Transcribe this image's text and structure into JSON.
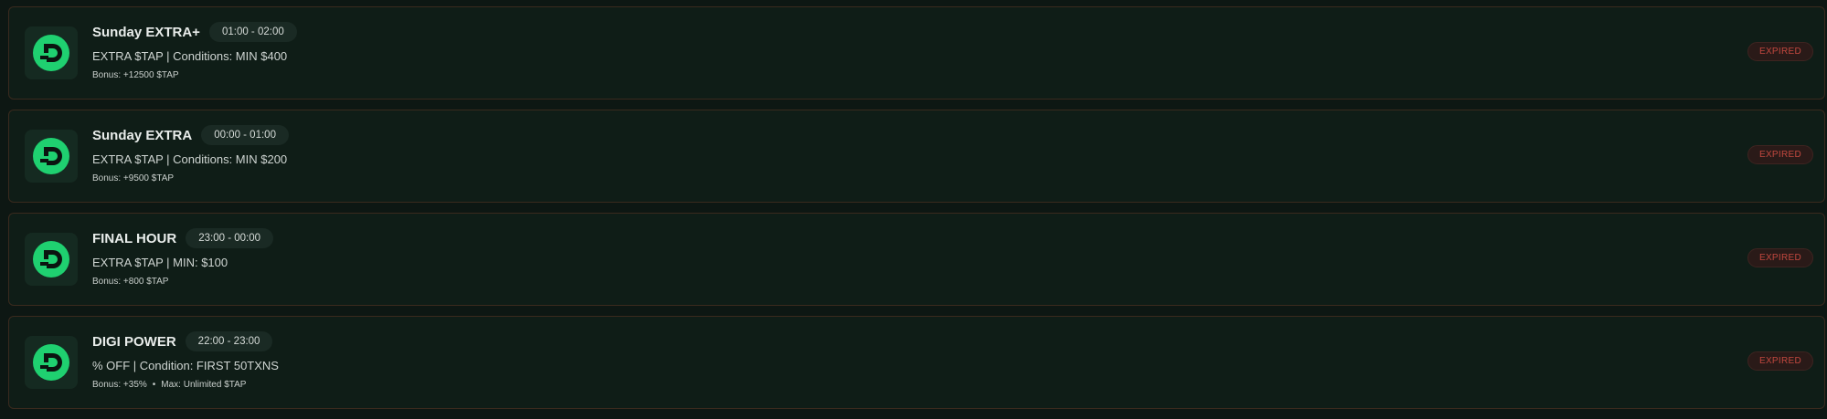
{
  "colors": {
    "background": "#0d1713",
    "card": "#0f1d17",
    "card_border": "#3a2a1e",
    "brand_green": "#1fd070",
    "expired_red": "#c2483f"
  },
  "promotions": [
    {
      "logo_icon": "digi-logo-icon",
      "title": "Sunday EXTRA+",
      "time": "01:00 - 02:00",
      "description": "EXTRA $TAP | Conditions: MIN $400",
      "bonus": "Bonus: +12500 $TAP",
      "max": "",
      "status": "EXPIRED"
    },
    {
      "logo_icon": "digi-logo-icon",
      "title": "Sunday EXTRA",
      "time": "00:00 - 01:00",
      "description": "EXTRA $TAP | Conditions: MIN $200",
      "bonus": "Bonus: +9500 $TAP",
      "max": "",
      "status": "EXPIRED"
    },
    {
      "logo_icon": "digi-logo-icon",
      "title": "FINAL HOUR",
      "time": "23:00 - 00:00",
      "description": "EXTRA $TAP | MIN: $100",
      "bonus": "Bonus: +800 $TAP",
      "max": "",
      "status": "EXPIRED"
    },
    {
      "logo_icon": "digi-logo-icon",
      "title": "DIGI POWER",
      "time": "22:00 - 23:00",
      "description": "% OFF | Condition: FIRST 50TXNS",
      "bonus": "Bonus: +35%",
      "max": "Max: Unlimited $TAP",
      "status": "EXPIRED"
    }
  ]
}
